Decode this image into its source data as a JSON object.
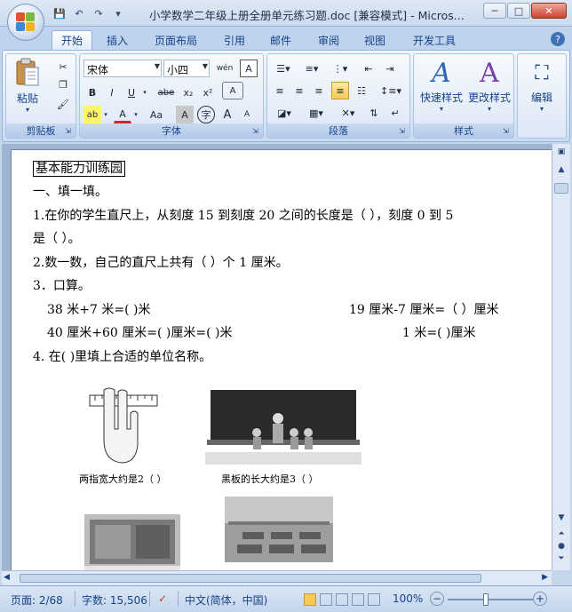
{
  "window": {
    "title": "小学数学二年级上册全册单元练习题.doc [兼容模式] - Micros...",
    "controls": {
      "minimize": "─",
      "maximize": "□",
      "close": "✕"
    }
  },
  "quick_access": {
    "save": "💾",
    "undo": "↶",
    "redo": "↷",
    "customize": "▾"
  },
  "tabs": [
    "开始",
    "插入",
    "页面布局",
    "引用",
    "邮件",
    "审阅",
    "视图",
    "开发工具"
  ],
  "active_tab": "开始",
  "help": "?",
  "ribbon": {
    "clipboard": {
      "label": "剪贴板",
      "paste": "粘贴"
    },
    "font": {
      "label": "字体",
      "font_name": "宋体",
      "font_size": "小四",
      "bold": "B",
      "italic": "I",
      "underline": "U",
      "strike": "abe",
      "subscript": "x₂",
      "superscript": "x²",
      "font_color": "A",
      "change_case": "Aa",
      "grow": "A",
      "shrink": "A",
      "pinyin": "wén",
      "border": "A",
      "char_shade": "A",
      "circle": "字",
      "clear": "A"
    },
    "paragraph": {
      "label": "段落"
    },
    "styles": {
      "label": "样式",
      "quick_styles": "快速样式",
      "change_styles": "更改样式"
    },
    "editing": {
      "label": "编辑",
      "button": "编辑"
    }
  },
  "document": {
    "heading": "基本能力训练园",
    "section1": "一、填一填。",
    "q1_line1": "1.在你的学生直尺上，从刻度 15 到刻度 20 之间的长度是（        ），刻度 0 到 5",
    "q1_line2": "是（        ）。",
    "q2": "2.数一数，自己的直尺上共有（     ）个 1 厘米。",
    "q3": "3．口算。",
    "calc_row1_left": "38 米+7 米=(            )米",
    "calc_row1_right": "19 厘米-7 厘米=（      ）厘米",
    "calc_row2_left": "40 厘米+60 厘米=(            )厘米=(            )米",
    "calc_row2_right": "1 米=(            )厘米",
    "q4": "4. 在(    )里填上合适的单位名称。",
    "caption1": "两指宽大约是2（    ）",
    "caption2": "黑板的长大约是3（    ）"
  },
  "statusbar": {
    "page": "页面: 2/68",
    "words": "字数: 15,506",
    "language": "中文(简体，中国)",
    "zoom": "100%",
    "zoom_minus": "−",
    "zoom_plus": "+"
  },
  "colors": {
    "accent": "#15428b",
    "ribbon_bg": "#dbe7f6",
    "highlight": "#f8c75a"
  }
}
